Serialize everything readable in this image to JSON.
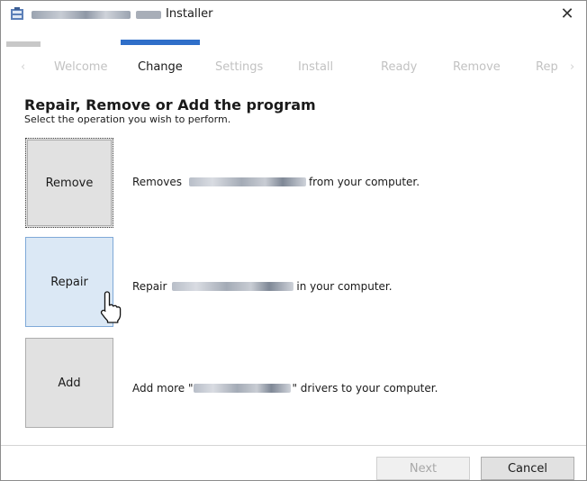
{
  "window": {
    "title_suffix": "Installer",
    "close_glyph": "✕"
  },
  "progress": {
    "current_step_index": 1
  },
  "steps": {
    "prev_arrow": "‹",
    "next_arrow": "›",
    "items": [
      "Welcome",
      "Change",
      "Settings",
      "Install",
      "Ready",
      "Remove",
      "Rep"
    ]
  },
  "main": {
    "heading": "Repair, Remove or Add the program",
    "subheading": "Select the operation you wish to perform."
  },
  "options": {
    "remove": {
      "label": "Remove",
      "desc_prefix": "Removes",
      "desc_suffix": "from your computer."
    },
    "repair": {
      "label": "Repair",
      "desc_prefix": "Repair",
      "desc_suffix": "in your computer."
    },
    "add": {
      "label": "Add",
      "desc_prefix": "Add more \"",
      "desc_suffix": "\" drivers to your computer."
    }
  },
  "footer": {
    "next_label": "Next",
    "cancel_label": "Cancel"
  },
  "colors": {
    "accent": "#2f6fc9",
    "hover_bg": "#dbe8f5"
  },
  "icons": {
    "app": "installer-app-icon",
    "close": "close-icon",
    "cursor": "mouse-pointer-icon"
  }
}
